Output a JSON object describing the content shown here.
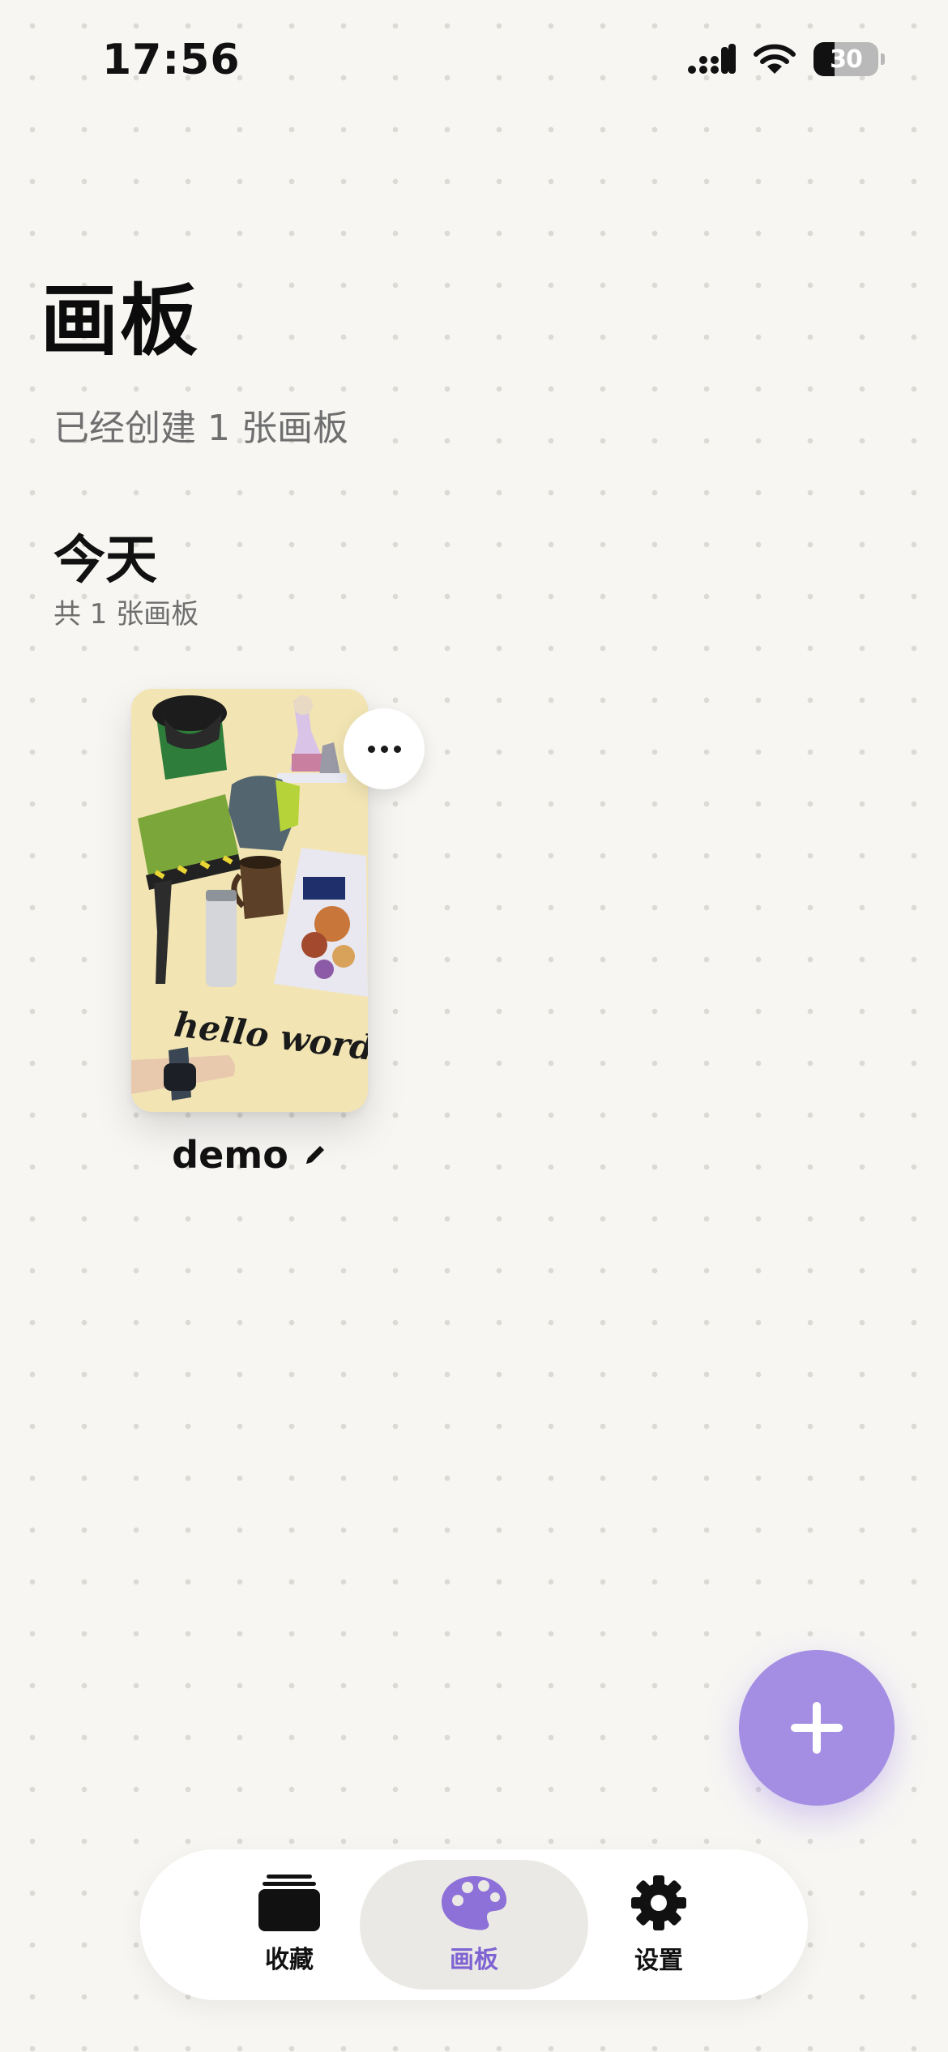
{
  "status_bar": {
    "time": "17:56",
    "battery_level": "30",
    "icons": [
      "signal-icon",
      "wifi-icon",
      "battery-icon"
    ]
  },
  "header": {
    "title": "画板",
    "subtitle": "已经创建 1 张画板"
  },
  "section": {
    "title": "今天",
    "count_label": "共 1 张画板"
  },
  "boards": [
    {
      "name": "demo",
      "thumbnail_text": "hello word",
      "more_icon": "ellipsis-icon",
      "edit_icon": "pencil-icon"
    }
  ],
  "fab": {
    "icon": "plus-icon",
    "color": "#a48ee3"
  },
  "tab_bar": {
    "tabs": [
      {
        "label": "收藏",
        "icon": "stack-icon",
        "active": false
      },
      {
        "label": "画板",
        "icon": "palette-icon",
        "active": true
      },
      {
        "label": "设置",
        "icon": "gear-icon",
        "active": false
      }
    ],
    "active_color": "#7e63d2"
  }
}
